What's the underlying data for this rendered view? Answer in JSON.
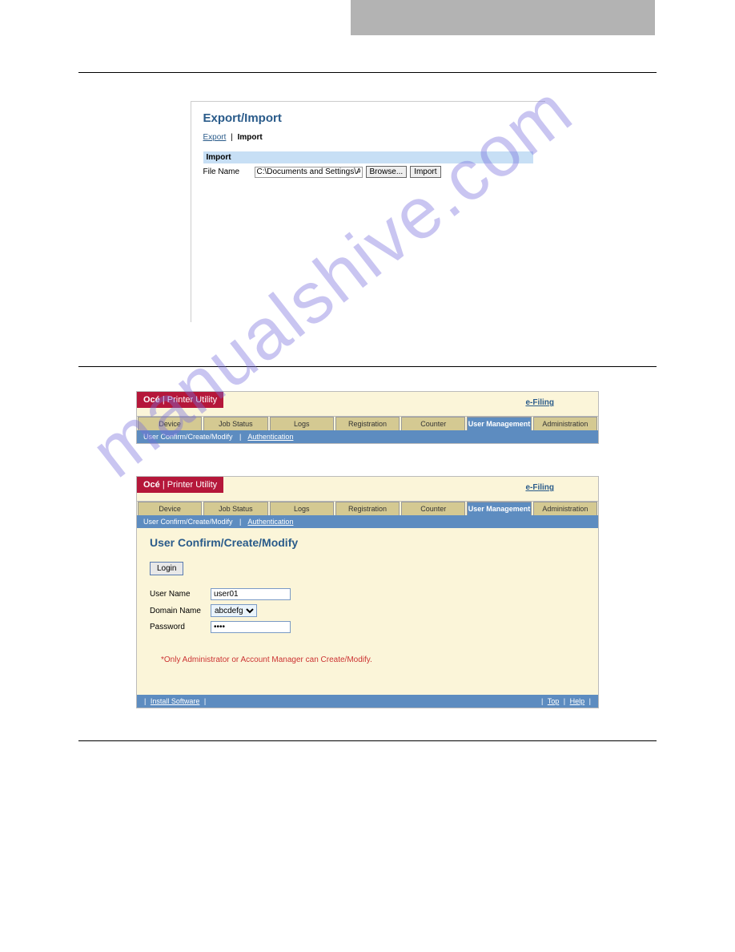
{
  "watermark": "manualshive.com",
  "screenshot1": {
    "title": "Export/Import",
    "tab_export": "Export",
    "tab_import": "Import",
    "section_header": "Import",
    "filename_label": "File Name",
    "filename_value": "C:\\Documents and Settings\\Adminis",
    "browse_btn": "Browse...",
    "import_btn": "Import"
  },
  "common": {
    "brand_oce": "Océ",
    "brand_sep": "|",
    "brand_utility": "Printer Utility",
    "efiling": "e-Filing",
    "tabs": {
      "device": "Device",
      "job_status": "Job Status",
      "logs": "Logs",
      "registration": "Registration",
      "counter": "Counter",
      "user_management": "User Management",
      "administration": "Administration"
    },
    "subnav_user": "User Confirm/Create/Modify",
    "subnav_auth": "Authentication",
    "subnav_sep": "|"
  },
  "screenshot3": {
    "form_title": "User Confirm/Create/Modify",
    "login_btn": "Login",
    "username_label": "User Name",
    "username_value": "user01",
    "domain_label": "Domain Name",
    "domain_value": "abcdefg",
    "password_label": "Password",
    "password_value": "••••",
    "note": "*Only Administrator or Account Manager can Create/Modify.",
    "footer_install": "Install Software",
    "footer_top": "Top",
    "footer_help": "Help",
    "footer_sep": "|"
  }
}
